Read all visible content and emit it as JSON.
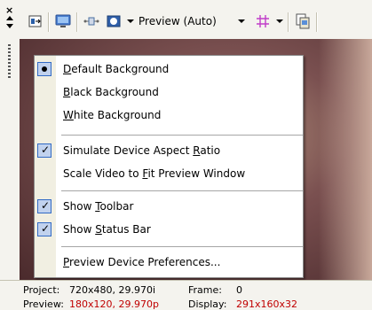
{
  "toolbar": {
    "preview_quality": "Preview (Auto)",
    "icons": [
      "split-screen-icon",
      "monitor-icon",
      "overlay-icon",
      "background-color-icon",
      "grid-icon",
      "copy-snapshot-icon"
    ]
  },
  "menu": {
    "items": [
      {
        "pre": "",
        "accel": "D",
        "post": "efault Background",
        "state": "radio"
      },
      {
        "pre": "",
        "accel": "B",
        "post": "lack Background",
        "state": "none"
      },
      {
        "pre": "",
        "accel": "W",
        "post": "hite Background",
        "state": "none"
      },
      {
        "pre": "Simulate Device Aspect ",
        "accel": "R",
        "post": "atio",
        "state": "checked"
      },
      {
        "pre": "Scale Video to ",
        "accel": "F",
        "post": "it Preview Window",
        "state": "none"
      },
      {
        "pre": "Show ",
        "accel": "T",
        "post": "oolbar",
        "state": "checked"
      },
      {
        "pre": "Show ",
        "accel": "S",
        "post": "tatus Bar",
        "state": "checked"
      },
      {
        "pre": "",
        "accel": "P",
        "post": "review Device Preferences...",
        "state": "none"
      }
    ]
  },
  "status": {
    "project_label": "Project:",
    "project_value": "720x480, 29.970i",
    "preview_label": "Preview:",
    "preview_value": "180x120, 29.970p",
    "frame_label": "Frame:",
    "frame_value": "0",
    "display_label": "Display:",
    "display_value": "291x160x32"
  }
}
